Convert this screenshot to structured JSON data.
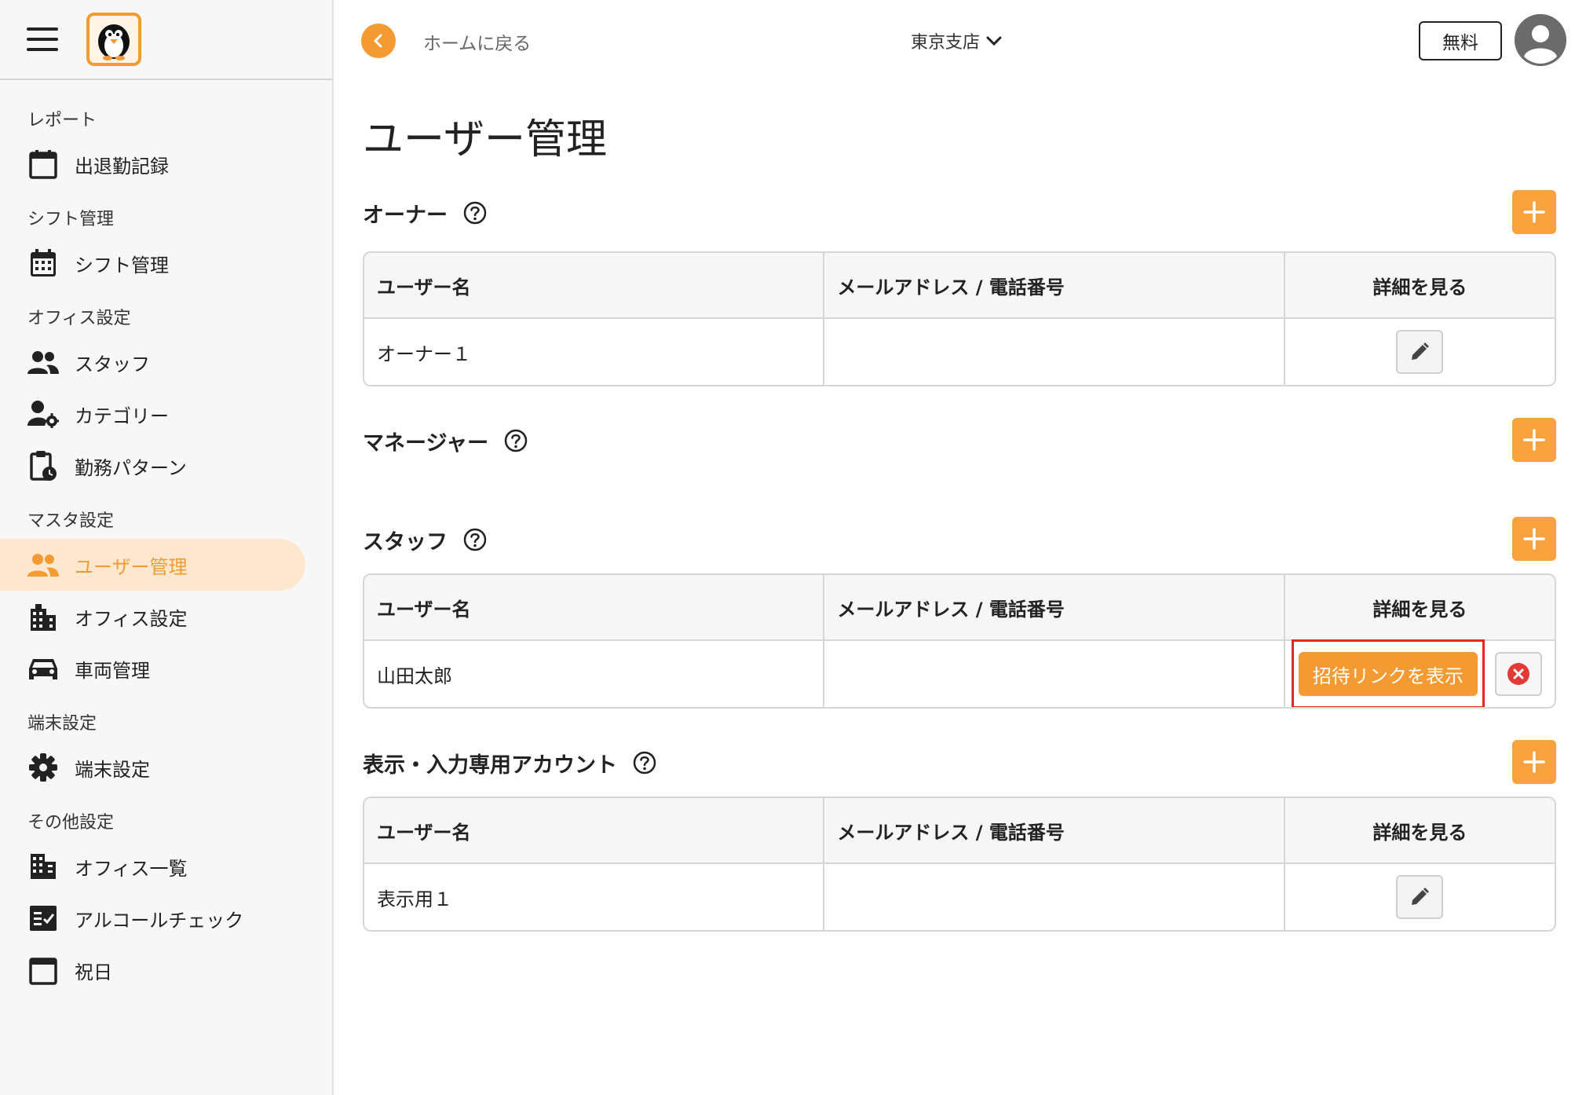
{
  "sidebar": {
    "sections": [
      {
        "title": "レポート",
        "items": [
          {
            "label": "出退勤記録",
            "icon": "calendar-icon"
          }
        ]
      },
      {
        "title": "シフト管理",
        "items": [
          {
            "label": "シフト管理",
            "icon": "calendar-grid-icon"
          }
        ]
      },
      {
        "title": "オフィス設定",
        "items": [
          {
            "label": "スタッフ",
            "icon": "people-icon"
          },
          {
            "label": "カテゴリー",
            "icon": "person-gear-icon"
          },
          {
            "label": "勤務パターン",
            "icon": "clipboard-clock-icon"
          }
        ]
      },
      {
        "title": "マスタ設定",
        "items": [
          {
            "label": "ユーザー管理",
            "icon": "people-icon",
            "active": true
          },
          {
            "label": "オフィス設定",
            "icon": "building-icon"
          },
          {
            "label": "車両管理",
            "icon": "car-icon"
          }
        ]
      },
      {
        "title": "端末設定",
        "items": [
          {
            "label": "端末設定",
            "icon": "gear-icon"
          }
        ]
      },
      {
        "title": "その他設定",
        "items": [
          {
            "label": "オフィス一覧",
            "icon": "building-list-icon"
          },
          {
            "label": "アルコールチェック",
            "icon": "checklist-icon"
          },
          {
            "label": "祝日",
            "icon": "calendar-icon"
          }
        ]
      }
    ]
  },
  "header": {
    "back_label": "ホームに戻る",
    "branch": "東京支店",
    "plan": "無料"
  },
  "page": {
    "title": "ユーザー管理"
  },
  "columns": {
    "name": "ユーザー名",
    "contact": "メールアドレス / 電話番号",
    "detail": "詳細を見る"
  },
  "owner": {
    "title": "オーナー",
    "rows": [
      {
        "name": "オーナー１",
        "contact": ""
      }
    ]
  },
  "manager": {
    "title": "マネージャー"
  },
  "staff": {
    "title": "スタッフ",
    "rows": [
      {
        "name": "山田太郎",
        "contact": "",
        "invite_label": "招待リンクを表示"
      }
    ]
  },
  "display": {
    "title": "表示・入力専用アカウント",
    "rows": [
      {
        "name": "表示用１",
        "contact": ""
      }
    ]
  },
  "colors": {
    "accent": "#f39a33",
    "active_bg": "#fde8cf",
    "highlight": "#e8261b",
    "delete": "#e53935"
  }
}
